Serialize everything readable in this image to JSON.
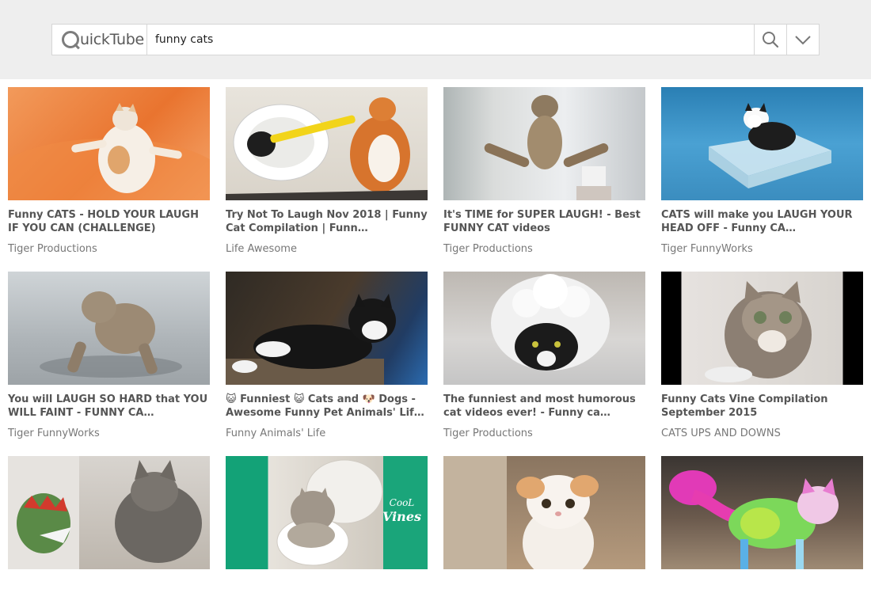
{
  "app": {
    "logo_text": "uickTube",
    "search": {
      "value": "funny cats"
    }
  },
  "icons": {
    "logo": "quicktube-logo-icon",
    "search": "search-icon",
    "menu": "chevron-down-icon"
  },
  "colors": {
    "header_bg": "#eeeeee",
    "title_text": "#555555",
    "channel_text": "#777777"
  },
  "videos": [
    {
      "title": "Funny CATS - HOLD YOUR LAUGH IF YOU CAN (CHALLENGE)",
      "channel": "Tiger Productions"
    },
    {
      "title": "Try Not To Laugh Nov 2018 | Funny Cat Compilation | Funn…",
      "channel": "Life Awesome"
    },
    {
      "title": "It's TIME for SUPER LAUGH! - Best FUNNY CAT videos",
      "channel": "Tiger Productions"
    },
    {
      "title": "CATS will make you LAUGH YOUR HEAD OFF - Funny CA…",
      "channel": "Tiger FunnyWorks"
    },
    {
      "title": "You will LAUGH SO HARD that YOU WILL FAINT - FUNNY CA…",
      "channel": "Tiger FunnyWorks"
    },
    {
      "title": "😺 Funniest 😺 Cats and 🐶 Dogs - Awesome Funny Pet Animals' Lif…",
      "channel": "Funny Animals' Life"
    },
    {
      "title": "The funniest and most humorous cat videos ever! - Funny ca…",
      "channel": "Tiger Productions"
    },
    {
      "title": "Funny Cats Vine Compilation September 2015",
      "channel": "CATS UPS AND DOWNS"
    },
    {
      "title": "",
      "channel": ""
    },
    {
      "title": "",
      "channel": ""
    },
    {
      "title": "",
      "channel": ""
    },
    {
      "title": "",
      "channel": ""
    }
  ],
  "thumb_overlay": {
    "text_line1": "CooL",
    "text_line2": "Vines"
  }
}
